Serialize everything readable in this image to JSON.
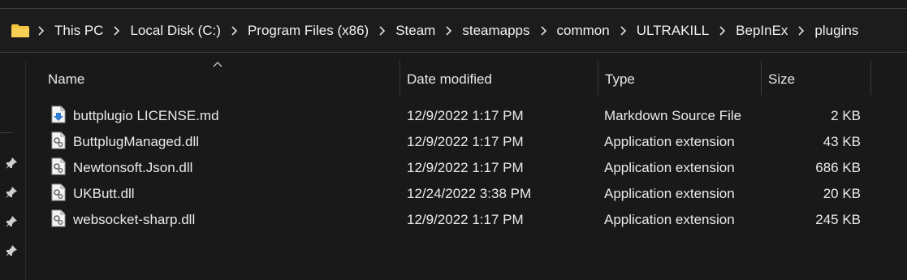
{
  "address_bar": {
    "icon": "folder-icon",
    "crumbs": [
      "This PC",
      "Local Disk (C:)",
      "Program Files (x86)",
      "Steam",
      "steamapps",
      "common",
      "ULTRAKILL",
      "BepInEx",
      "plugins"
    ]
  },
  "columns": {
    "name": "Name",
    "date": "Date modified",
    "type": "Type",
    "size": "Size"
  },
  "files": [
    {
      "icon": "markdown-file-icon",
      "name": "buttplugio LICENSE.md",
      "date": "12/9/2022 1:17 PM",
      "type": "Markdown Source File",
      "size": "2 KB"
    },
    {
      "icon": "dll-file-icon",
      "name": "ButtplugManaged.dll",
      "date": "12/9/2022 1:17 PM",
      "type": "Application extension",
      "size": "43 KB"
    },
    {
      "icon": "dll-file-icon",
      "name": "Newtonsoft.Json.dll",
      "date": "12/9/2022 1:17 PM",
      "type": "Application extension",
      "size": "686 KB"
    },
    {
      "icon": "dll-file-icon",
      "name": "UKButt.dll",
      "date": "12/24/2022 3:38 PM",
      "type": "Application extension",
      "size": "20 KB"
    },
    {
      "icon": "dll-file-icon",
      "name": "websocket-sharp.dll",
      "date": "12/9/2022 1:17 PM",
      "type": "Application extension",
      "size": "245 KB"
    }
  ],
  "colors": {
    "background": "#191919",
    "folder": "#f3c33c",
    "text": "#eaeaea"
  }
}
